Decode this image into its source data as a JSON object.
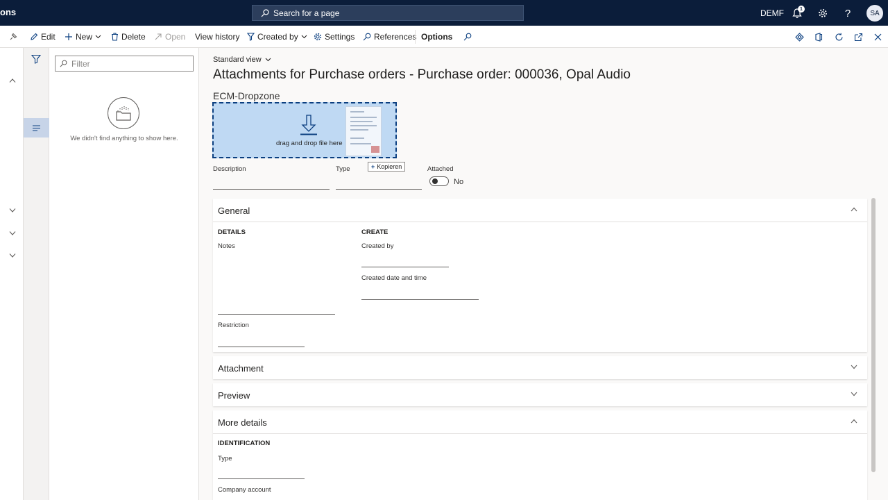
{
  "topbar": {
    "app_name": "ons",
    "search_label": "Search for a page",
    "company": "DEMF",
    "notification_count": "1",
    "user_initials": "SA"
  },
  "actionbar": {
    "edit": "Edit",
    "new": "New",
    "delete": "Delete",
    "open": "Open",
    "view_history": "View history",
    "created_by": "Created by",
    "settings": "Settings",
    "references": "References",
    "options": "Options"
  },
  "listpane": {
    "filter_placeholder": "Filter",
    "empty_message": "We didn't find anything to show here."
  },
  "main": {
    "view_selector": "Standard view",
    "page_title": "Attachments for Purchase orders - Purchase order: 000036, Opal Audio",
    "dropzone_title": "ECM-Dropzone",
    "dropzone_text": "drag and drop file here",
    "drag_tooltip": "Kopieren",
    "fields": {
      "description_label": "Description",
      "type_label": "Type",
      "attached_label": "Attached",
      "attached_value": "No"
    }
  },
  "general": {
    "header": "General",
    "details_header": "DETAILS",
    "notes_label": "Notes",
    "restriction_label": "Restriction",
    "create_header": "CREATE",
    "created_by_label": "Created by",
    "created_datetime_label": "Created date and time"
  },
  "attachment": {
    "header": "Attachment"
  },
  "preview": {
    "header": "Preview"
  },
  "more_details": {
    "header": "More details",
    "identification_header": "IDENTIFICATION",
    "type_label": "Type",
    "company_account_label": "Company account"
  },
  "colors": {
    "topbar_bg": "#0b1d3a",
    "dropzone_bg": "#bfd9f3",
    "dropzone_border": "#0b3f80",
    "selected_rail": "#c7d4e8"
  }
}
